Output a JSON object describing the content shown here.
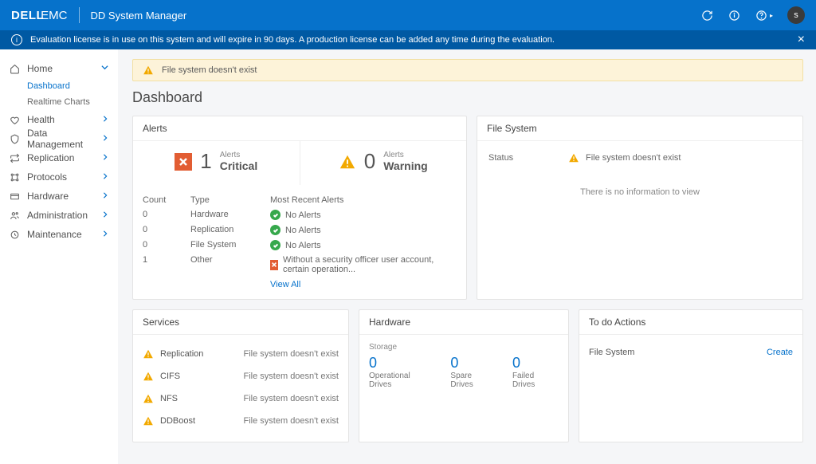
{
  "header": {
    "brand_left": "DELL",
    "brand_right": "EMC",
    "app_name": "DD System Manager",
    "avatar_letter": "s"
  },
  "notice": {
    "text": "Evaluation license is in use on this system and will expire in 90 days. A production license can be added any time during the evaluation."
  },
  "sidebar": {
    "items": [
      {
        "label": "Home",
        "expanded": true,
        "sub": [
          {
            "label": "Dashboard",
            "active": true
          },
          {
            "label": "Realtime Charts",
            "active": false
          }
        ]
      },
      {
        "label": "Health"
      },
      {
        "label": "Data Management"
      },
      {
        "label": "Replication"
      },
      {
        "label": "Protocols"
      },
      {
        "label": "Hardware"
      },
      {
        "label": "Administration"
      },
      {
        "label": "Maintenance"
      }
    ]
  },
  "banner": {
    "text": "File system doesn't exist"
  },
  "page_title": "Dashboard",
  "alerts": {
    "title": "Alerts",
    "critical": {
      "count": "1",
      "top": "Alerts",
      "bottom": "Critical"
    },
    "warning": {
      "count": "0",
      "top": "Alerts",
      "bottom": "Warning"
    },
    "columns": {
      "count": "Count",
      "type": "Type",
      "recent": "Most Recent Alerts"
    },
    "rows": [
      {
        "count": "0",
        "type": "Hardware",
        "status": "ok",
        "msg": "No Alerts"
      },
      {
        "count": "0",
        "type": "Replication",
        "status": "ok",
        "msg": "No Alerts"
      },
      {
        "count": "0",
        "type": "File System",
        "status": "ok",
        "msg": "No Alerts"
      },
      {
        "count": "1",
        "type": "Other",
        "status": "crit",
        "msg": "Without a security officer user account, certain operation..."
      }
    ],
    "view_all": "View All"
  },
  "filesystem": {
    "title": "File System",
    "status_label": "Status",
    "status_text": "File system doesn't exist",
    "no_info": "There is no information to view"
  },
  "services": {
    "title": "Services",
    "rows": [
      {
        "name": "Replication",
        "msg": "File system doesn't exist"
      },
      {
        "name": "CIFS",
        "msg": "File system doesn't exist"
      },
      {
        "name": "NFS",
        "msg": "File system doesn't exist"
      },
      {
        "name": "DDBoost",
        "msg": "File system doesn't exist"
      }
    ]
  },
  "hardware": {
    "title": "Hardware",
    "storage_label": "Storage",
    "drives": [
      {
        "num": "0",
        "label": "Operational Drives"
      },
      {
        "num": "0",
        "label": "Spare Drives"
      },
      {
        "num": "0",
        "label": "Failed Drives"
      }
    ]
  },
  "todo": {
    "title": "To do Actions",
    "rows": [
      {
        "name": "File System",
        "action": "Create"
      }
    ]
  }
}
